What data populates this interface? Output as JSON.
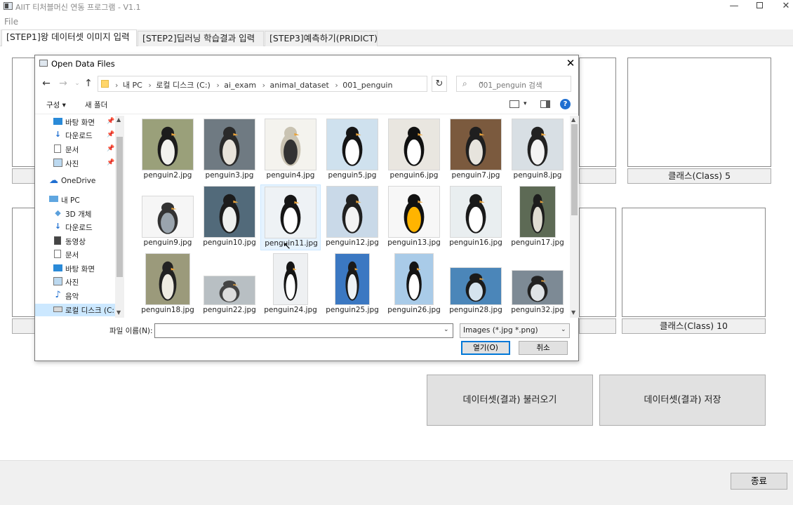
{
  "app": {
    "title": "AIIT 티처블머신 연동 프로그램 - V1.1",
    "menu_file": "File",
    "window_buttons": {
      "minimize": "—",
      "close": "✕"
    }
  },
  "tabs": [
    {
      "label": "[STEP1]왕 데이터셋 이미지 입력",
      "active": true
    },
    {
      "label": "[STEP2]딥러닝 학습결과 입력",
      "active": false
    },
    {
      "label": "[STEP3]예측하기(PRIDICT)",
      "active": false
    }
  ],
  "classes": {
    "class5": "클래스(Class) 5",
    "class10": "클래스(Class) 10"
  },
  "buttons": {
    "load": "데이터셋(결과) 불러오기",
    "save": "데이터셋(결과) 저장",
    "exit": "종료"
  },
  "dialog": {
    "title": "Open Data Files",
    "close": "✕",
    "breadcrumbs": [
      "내 PC",
      "로컬 디스크 (C:)",
      "ai_exam",
      "animal_dataset",
      "001_penguin"
    ],
    "search_placeholder": "001_penguin 검색",
    "toolbar": {
      "organize": "구성 ▾",
      "new_folder": "새 폴더",
      "help": "?"
    },
    "nav": [
      {
        "label": "바탕 화면",
        "icon": "desktop-icon",
        "pinned": true
      },
      {
        "label": "다운로드",
        "icon": "download-icon",
        "pinned": true
      },
      {
        "label": "문서",
        "icon": "document-icon",
        "pinned": true
      },
      {
        "label": "사진",
        "icon": "picture-icon",
        "pinned": true
      },
      {
        "label": "OneDrive",
        "icon": "cloud-icon",
        "pinned": false
      },
      {
        "label": "내 PC",
        "icon": "pc-icon",
        "pinned": false
      },
      {
        "label": "3D 개체",
        "icon": "cube-icon",
        "pinned": false
      },
      {
        "label": "다운로드",
        "icon": "download-icon",
        "pinned": false
      },
      {
        "label": "동영상",
        "icon": "video-icon",
        "pinned": false
      },
      {
        "label": "문서",
        "icon": "document-icon",
        "pinned": false
      },
      {
        "label": "바탕 화면",
        "icon": "desktop-icon",
        "pinned": false
      },
      {
        "label": "사진",
        "icon": "picture-icon",
        "pinned": false
      },
      {
        "label": "음악",
        "icon": "music-icon",
        "pinned": false
      },
      {
        "label": "로컬 디스크 (C:)",
        "icon": "drive-icon",
        "pinned": false,
        "selected": true
      }
    ],
    "files": [
      "penguin2.jpg",
      "penguin3.jpg",
      "penguin4.jpg",
      "penguin5.jpg",
      "penguin6.jpg",
      "penguin7.jpg",
      "penguin8.jpg",
      "penguin9.jpg",
      "penguin10.jpg",
      "penguin11.jpg",
      "penguin12.jpg",
      "penguin13.jpg",
      "penguin16.jpg",
      "penguin17.jpg",
      "penguin18.jpg",
      "penguin22.jpg",
      "penguin24.jpg",
      "penguin25.jpg",
      "penguin26.jpg",
      "penguin28.jpg",
      "penguin32.jpg"
    ],
    "selected_file": "penguin11.jpg",
    "filename_label": "파일 이름(N):",
    "filename_value": "",
    "filter_value": "Images (*.jpg *.png)",
    "open_label": "열기(O)",
    "cancel_label": "취소"
  },
  "colors": {
    "accent": "#0078d7",
    "selection": "#cce8ff"
  }
}
